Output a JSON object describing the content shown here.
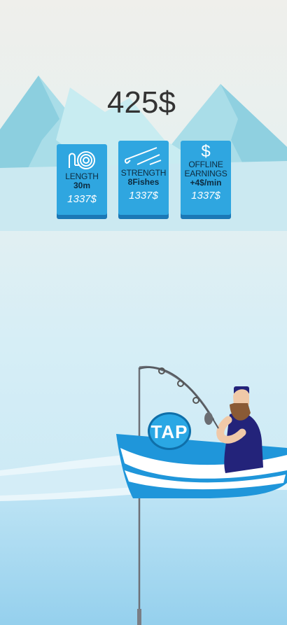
{
  "hud": {
    "money": "425$"
  },
  "upgrades": [
    {
      "icon": "rope-coil-icon",
      "label": "LENGTH",
      "value": "30m",
      "price": "1337$"
    },
    {
      "icon": "fishing-hook-icon",
      "label": "STRENGTH",
      "value": "8Fishes",
      "price": "1337$"
    },
    {
      "icon": "dollar-icon",
      "label_line1": "OFFLINE",
      "label_line2": "EARNINGS",
      "value": "+4$/min",
      "price": "1337$"
    }
  ],
  "tap_button": {
    "label": "TAP"
  },
  "colors": {
    "sky_top": "#f1f1ee",
    "sea": "#9ad3ec",
    "card": "#2fa6e0",
    "card_shadow": "#1b78b6",
    "boat": "#1f96da",
    "fisherman": "#23237a"
  }
}
